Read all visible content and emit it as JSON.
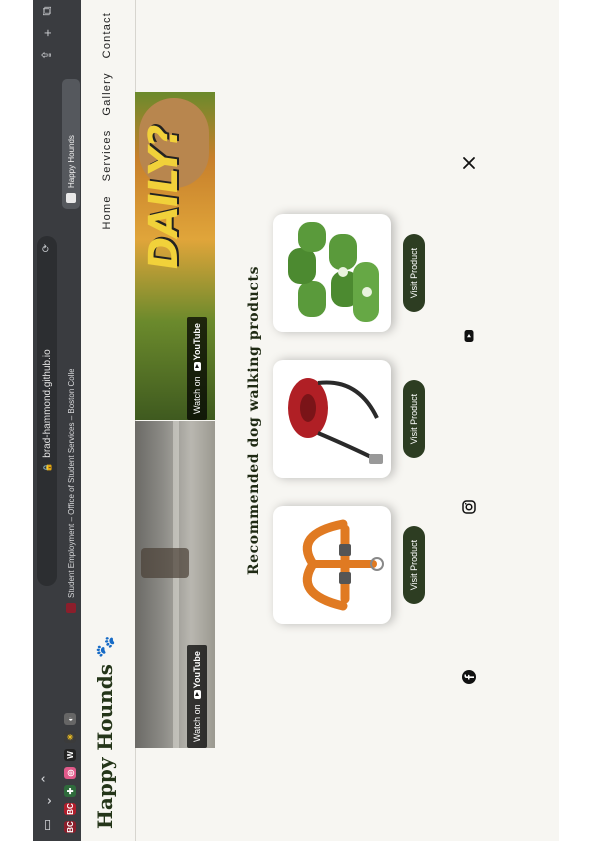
{
  "browser": {
    "url": "brad-hammond.github.io",
    "tabs": [
      {
        "label": "Student Employment – Office of Student Services – Boston College",
        "active": false
      },
      {
        "label": "Happy Hounds",
        "active": true
      }
    ]
  },
  "site": {
    "brand": "Happy Hounds",
    "paw_icon": "paw-icon",
    "nav": [
      "Home",
      "Services",
      "Gallery",
      "Contact"
    ],
    "videos": [
      {
        "overlay": "Watch on",
        "provider": "YouTube"
      },
      {
        "overlay": "Watch on",
        "provider": "YouTube",
        "thumb_text": "DAILY?"
      }
    ],
    "section_title": "Recommended dog walking products",
    "products": [
      {
        "name": "harness",
        "button": "Visit Product"
      },
      {
        "name": "retractable-leash",
        "button": "Visit Product"
      },
      {
        "name": "poop-bags",
        "button": "Visit Product"
      }
    ],
    "social": [
      "facebook-icon",
      "instagram-icon",
      "youtube-icon",
      "x-icon"
    ]
  }
}
